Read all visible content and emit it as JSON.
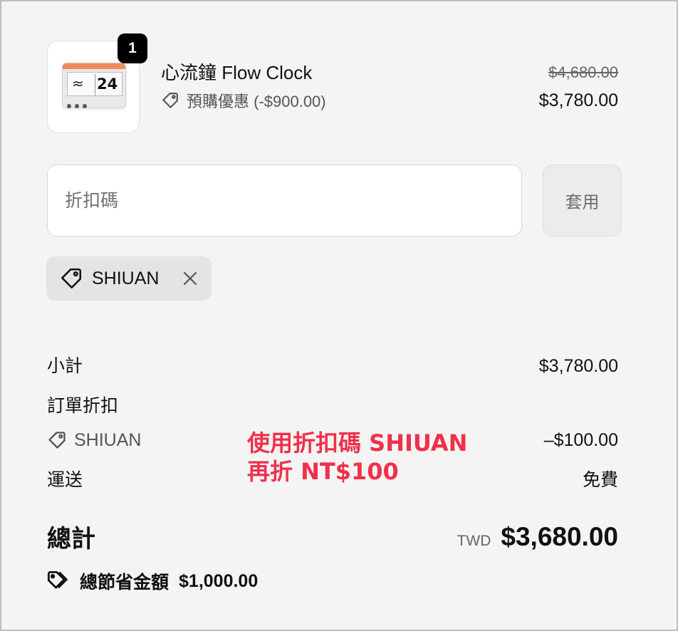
{
  "product": {
    "quantity": "1",
    "name": "心流鐘 Flow Clock",
    "promo_label": "預購優惠 (-$900.00)",
    "original_price": "$4,680.00",
    "price": "$3,780.00",
    "image_screen_text": "24"
  },
  "discount": {
    "input_placeholder": "折扣碼",
    "input_value": "",
    "apply_label": "套用",
    "applied_code": "SHIUAN"
  },
  "summary": {
    "subtotal_label": "小計",
    "subtotal_value": "$3,780.00",
    "order_discount_label": "訂單折扣",
    "discount_code_label": "SHIUAN",
    "discount_code_value": "–$100.00",
    "shipping_label": "運送",
    "shipping_value": "免費",
    "total_label": "總計",
    "currency": "TWD",
    "total_value": "$3,680.00",
    "savings_label": "總節省金額",
    "savings_value": "$1,000.00"
  },
  "annotation": {
    "line1": "使用折扣碼 SHIUAN",
    "line2": "再折 NT$100"
  },
  "colors": {
    "annotation": "#f0304c",
    "badge_bg": "#000000",
    "panel_bg": "#f4f4f4"
  },
  "icons": [
    "tag-icon",
    "close-icon",
    "tags-icon"
  ]
}
